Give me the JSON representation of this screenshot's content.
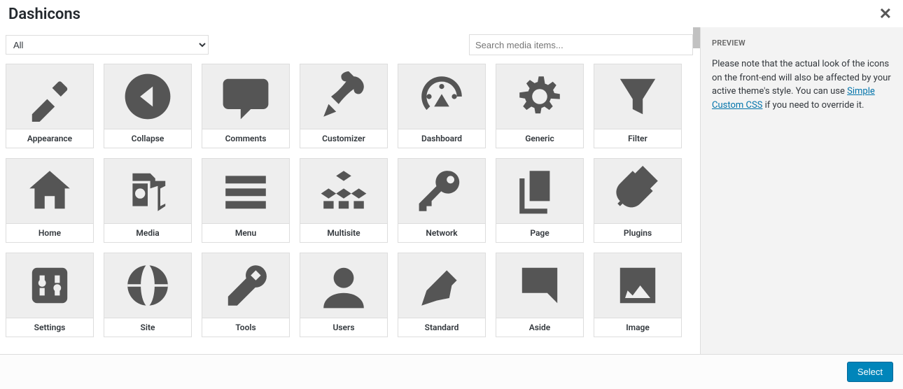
{
  "header": {
    "title": "Dashicons"
  },
  "toolbar": {
    "filter_selected": "All",
    "search_placeholder": "Search media items..."
  },
  "sidebar": {
    "heading": "PREVIEW",
    "text_before": "Please note that the actual look of the icons on the front-end will also be affected by your active theme's style. You can use ",
    "link_text": "Simple Custom CSS",
    "text_after": " if you need to override it."
  },
  "footer": {
    "select_label": "Select"
  },
  "icons": [
    {
      "name": "appearance",
      "label": "Appearance"
    },
    {
      "name": "collapse",
      "label": "Collapse"
    },
    {
      "name": "comments",
      "label": "Comments"
    },
    {
      "name": "customizer",
      "label": "Customizer"
    },
    {
      "name": "dashboard",
      "label": "Dashboard"
    },
    {
      "name": "generic",
      "label": "Generic"
    },
    {
      "name": "filter",
      "label": "Filter"
    },
    {
      "name": "home",
      "label": "Home"
    },
    {
      "name": "media",
      "label": "Media"
    },
    {
      "name": "menu",
      "label": "Menu"
    },
    {
      "name": "multisite",
      "label": "Multisite"
    },
    {
      "name": "network",
      "label": "Network"
    },
    {
      "name": "page",
      "label": "Page"
    },
    {
      "name": "plugins",
      "label": "Plugins"
    },
    {
      "name": "settings",
      "label": "Settings"
    },
    {
      "name": "site",
      "label": "Site"
    },
    {
      "name": "tools",
      "label": "Tools"
    },
    {
      "name": "users",
      "label": "Users"
    },
    {
      "name": "standard",
      "label": "Standard"
    },
    {
      "name": "aside",
      "label": "Aside"
    },
    {
      "name": "image",
      "label": "Image"
    }
  ]
}
